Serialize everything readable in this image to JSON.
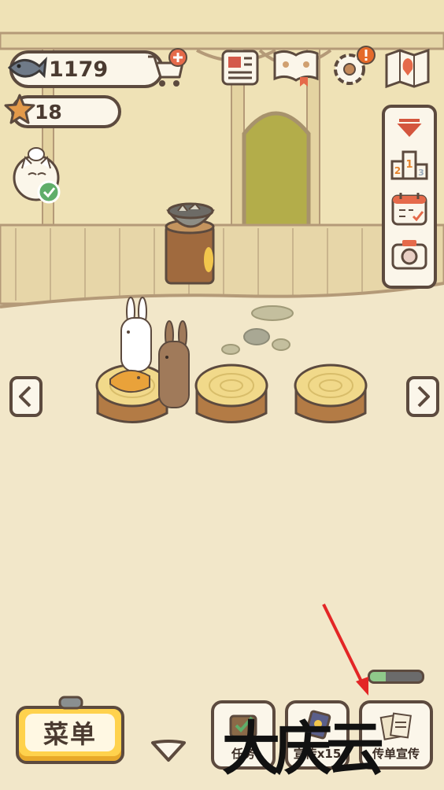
{
  "hud": {
    "fish_count": "1179",
    "star_count": "18"
  },
  "top_icons": [
    "fish-icon",
    "shopping-cart-plus-icon",
    "newspaper-icon",
    "paw-book-icon",
    "gear-alert-icon",
    "map-icon"
  ],
  "side_panel": [
    "collapse-arrow-icon",
    "podium-ranking-icon",
    "calendar-icon",
    "camera-icon"
  ],
  "bottom": {
    "menu_label": "菜单",
    "tasks_label": "任务",
    "promo_label": "宣传x15",
    "flyer_label": "传单宣传",
    "flyer_progress": 0.3
  },
  "watermark": "大庆云",
  "colors": {
    "outline": "#5c4a3e",
    "menu_yellow": "#ffd24d",
    "progress_green": "#8fc98a",
    "annotation_red": "#e32626"
  }
}
